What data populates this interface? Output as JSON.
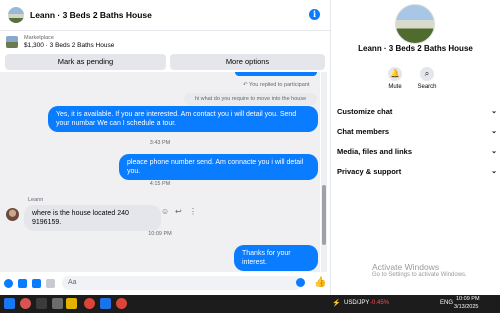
{
  "conversation": {
    "title": "Leann · 3 Beds 2 Baths House",
    "info_icon": "info-icon"
  },
  "marketplace": {
    "label": "Marketplace",
    "subtitle": "$1,300 · 3 Beds 2 Baths House"
  },
  "actions": {
    "mark_pending": "Mark as pending",
    "more_options": "More options"
  },
  "messages": {
    "replied_note": "You replied to participant",
    "quoted": "hi what do you require to move into the house",
    "out1": "Yes, it is available. If you are interested. Am contact you i will detail you. Send your numbar We can I schedule a tour.",
    "ts1": "3:43 PM",
    "out2": "pleace phone number send. Am connacte you i will detail you.",
    "ts2": "4:15 PM",
    "sender": "Leann",
    "in1": "where is the house located 240 9196159.",
    "ts3": "10:09 PM",
    "out3": "Thanks for your interest."
  },
  "composer": {
    "placeholder": "Aa"
  },
  "right_panel": {
    "title": "Leann · 3 Beds 2 Baths House",
    "mute_label": "Mute",
    "search_label": "Search",
    "sections": [
      "Customize chat",
      "Chat members",
      "Media, files and links",
      "Privacy & support"
    ]
  },
  "watermark": {
    "line1": "Activate Windows",
    "line2": "Go to Settings to activate Windows."
  },
  "taskbar": {
    "ticker": "USD/JPY",
    "ticker_change": "-0.45%",
    "lang": "ENG",
    "time": "10:09 PM",
    "date": "3/13/2025"
  },
  "colors": {
    "accent": "#0a7cff",
    "negative": "#ff4d4d"
  }
}
